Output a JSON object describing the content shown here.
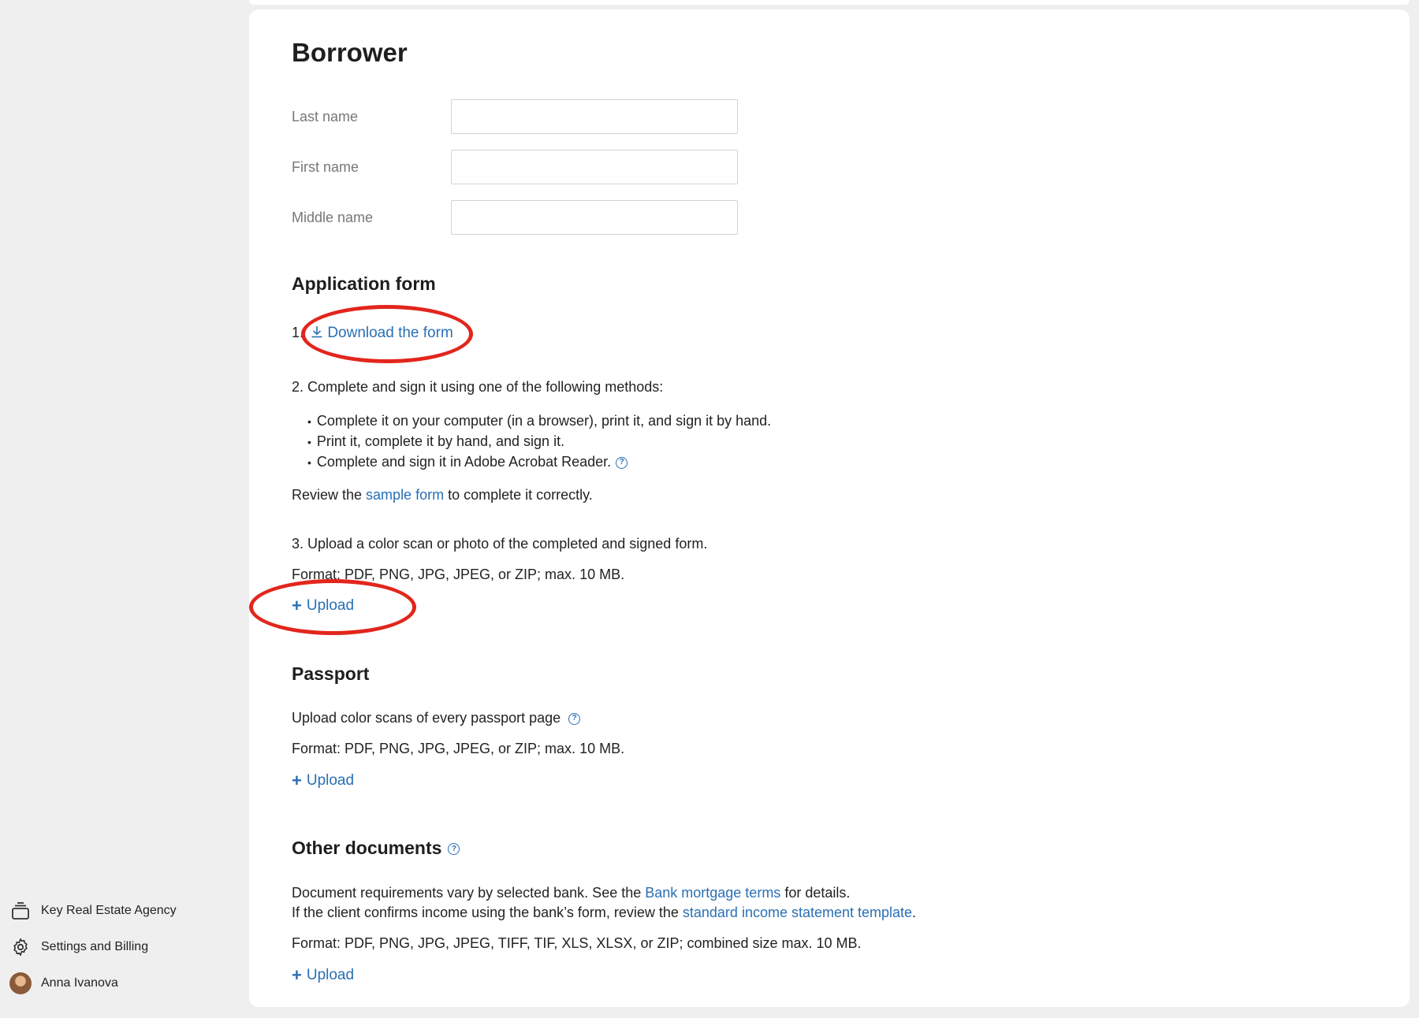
{
  "sidebar": {
    "items": [
      {
        "label": "Key Real Estate Agency",
        "icon": "agency-stack-icon"
      },
      {
        "label": "Settings and Billing",
        "icon": "gear-icon"
      },
      {
        "label": "Anna Ivanova",
        "icon": "avatar"
      }
    ]
  },
  "borrower": {
    "title": "Borrower",
    "fields": [
      {
        "label": "Last name",
        "value": ""
      },
      {
        "label": "First name",
        "value": ""
      },
      {
        "label": "Middle name",
        "value": ""
      }
    ]
  },
  "application_form": {
    "title": "Application form",
    "step1_number": "1.",
    "download_label": "Download the form",
    "step2": "2. Complete and sign it using one of the following methods:",
    "methods": [
      "Complete it on your computer (in a browser), print it, and sign it by hand.",
      "Print it, complete it by hand, and sign it.",
      "Complete and sign it in Adobe Acrobat Reader."
    ],
    "review_prefix": "Review the ",
    "review_link": "sample form",
    "review_suffix": " to complete it correctly.",
    "step3": "3. Upload a color scan or photo of the completed and signed form.",
    "format": "Format: PDF, PNG, JPG, JPEG, or ZIP; max. 10 MB.",
    "upload_label": "Upload"
  },
  "passport": {
    "title": "Passport",
    "instruction": "Upload color scans of every passport page",
    "format": "Format: PDF, PNG, JPG, JPEG, or ZIP; max. 10 MB.",
    "upload_label": "Upload"
  },
  "other_documents": {
    "title": "Other documents",
    "line1_prefix": "Document requirements vary by selected bank. See the ",
    "line1_link": "Bank mortgage terms",
    "line1_suffix": " for details.",
    "line2_prefix": "If the client confirms income using the bank’s form, review the ",
    "line2_link": "standard income statement template",
    "line2_suffix": ".",
    "format": "Format: PDF, PNG, JPG, JPEG, TIFF, TIF, XLS, XLSX, or ZIP; combined size max. 10 MB.",
    "upload_label": "Upload"
  },
  "colors": {
    "link": "#2a6fb5",
    "annotation": "#e2261c",
    "background": "#efefef",
    "card": "#ffffff"
  }
}
